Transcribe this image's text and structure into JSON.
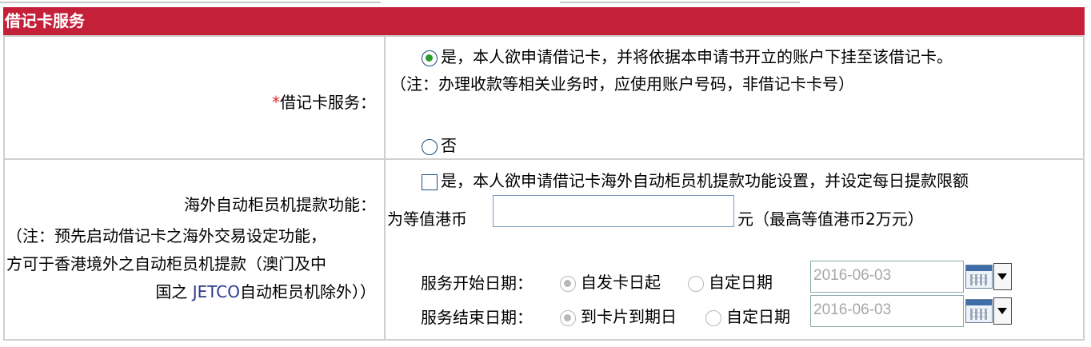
{
  "section": {
    "title": "借记卡服务"
  },
  "debit_card": {
    "required_mark": "*",
    "label": "借记卡服务：",
    "yes_option": "是，本人欲申请借记卡，并将依据本申请书开立的账户下挂至该借记卡。",
    "yes_note": "（注：办理收款等相关业务时，应使用账户号码，非借记卡卡号）",
    "no_option": "否",
    "selected": "yes"
  },
  "overseas_atm": {
    "label": "海外自动柜员机提款功能：",
    "note_line1": "（注：预先启动借记卡之海外交易设定功能，",
    "note_line2": "方可于香港境外之自动柜员机提款（澳门及中",
    "note_line3_a": "国之 ",
    "note_line3_b": "JETCO",
    "note_line3_c": "自动柜员机除外））",
    "checkbox_label": "是，本人欲申请借记卡海外自动柜员机提款功能设置，并设定每日提款限额",
    "amount_prefix": "为等值港币",
    "amount_value": "",
    "amount_suffix": "元（最高等值港币2万元）",
    "checked": false
  },
  "service_start": {
    "label": "服务开始日期：",
    "option_default": "自发卡日起",
    "option_custom": "自定日期",
    "date_value": "2016-06-03"
  },
  "service_end": {
    "label": "服务结束日期：",
    "option_default": "到卡片到期日",
    "option_custom": "自定日期",
    "date_value": "2016-06-03"
  },
  "icons": {
    "radio": "radio-icon",
    "checkbox": "checkbox-icon",
    "calendar": "calendar-icon",
    "dropdown": "chevron-down-icon"
  },
  "colors": {
    "header_bg": "#c5203a",
    "required": "#e0282a",
    "radio_dot": "#2c9a2c"
  }
}
